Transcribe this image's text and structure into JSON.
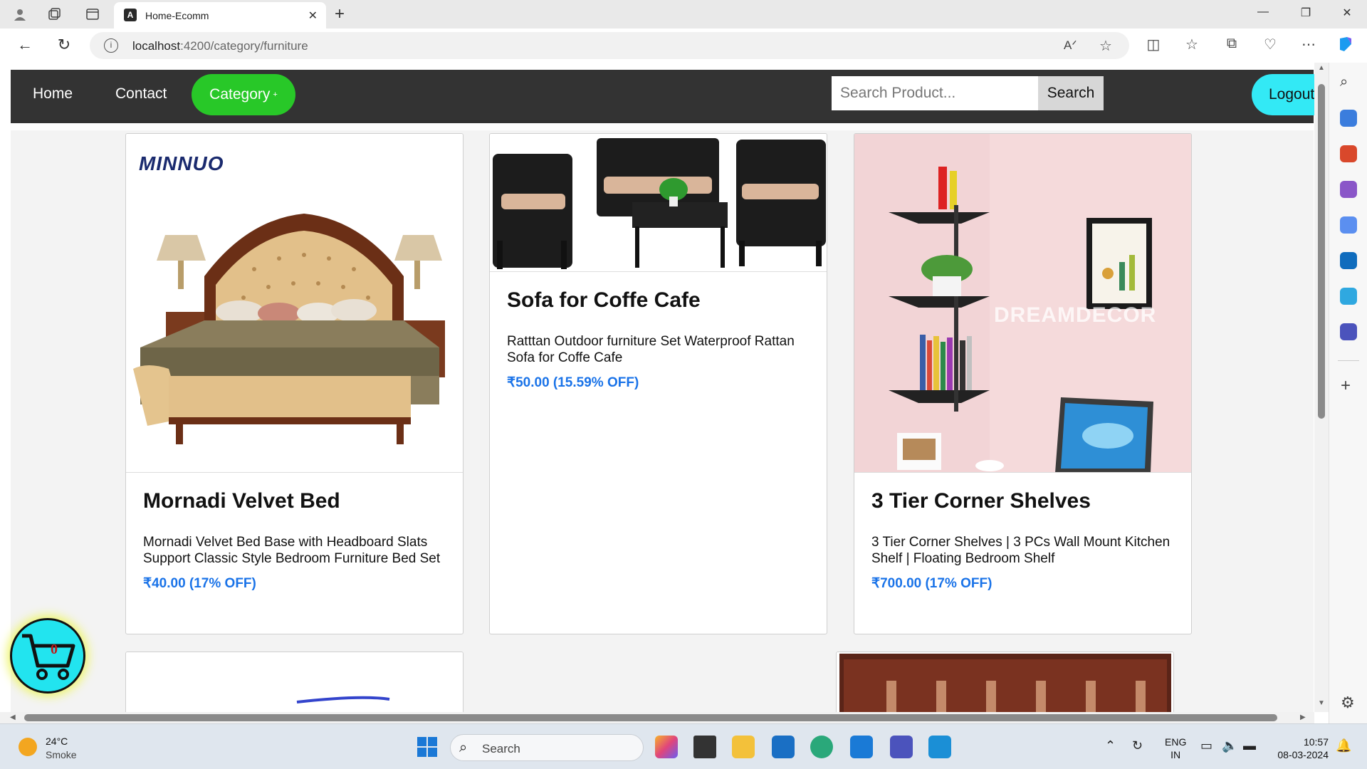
{
  "browser": {
    "tab_title": "Home-Ecomm",
    "url_host": "localhost",
    "url_path": ":4200/category/furniture"
  },
  "navbar": {
    "home": "Home",
    "contact": "Contact",
    "category": "Category",
    "category_marker": "+",
    "search_placeholder": "Search Product...",
    "search_button": "Search",
    "logout": "Logout"
  },
  "products": [
    {
      "title": "Mornadi Velvet Bed",
      "description": "Mornadi Velvet Bed Base with Headboard Slats Support Classic Style Bedroom Furniture Bed Set",
      "price": "₹40.00 (17% OFF)",
      "image_brand": "MINNUO"
    },
    {
      "title": "Sofa for Coffe Cafe",
      "description": "Ratttan Outdoor furniture Set Waterproof Rattan Sofa for Coffe Cafe",
      "price": "₹50.00 (15.59% OFF)"
    },
    {
      "title": "3 Tier Corner Shelves",
      "description": "3 Tier Corner Shelves | 3 PCs Wall Mount Kitchen Shelf | Floating Bedroom Shelf",
      "price": "₹700.00 (17% OFF)",
      "image_watermark": "DREAMDECOR"
    }
  ],
  "cart": {
    "count": "0",
    "icon": "cart-icon"
  },
  "taskbar": {
    "temperature": "24°C",
    "weather": "Smoke",
    "search_label": "Search",
    "lang_primary": "ENG",
    "lang_secondary": "IN",
    "time": "10:57",
    "date": "08-03-2024"
  },
  "colors": {
    "navbar_bg": "#333333",
    "category_bg": "#28c828",
    "logout_bg": "#33e9f5",
    "price": "#1a73e8",
    "cart_bg": "#22e4ef"
  }
}
